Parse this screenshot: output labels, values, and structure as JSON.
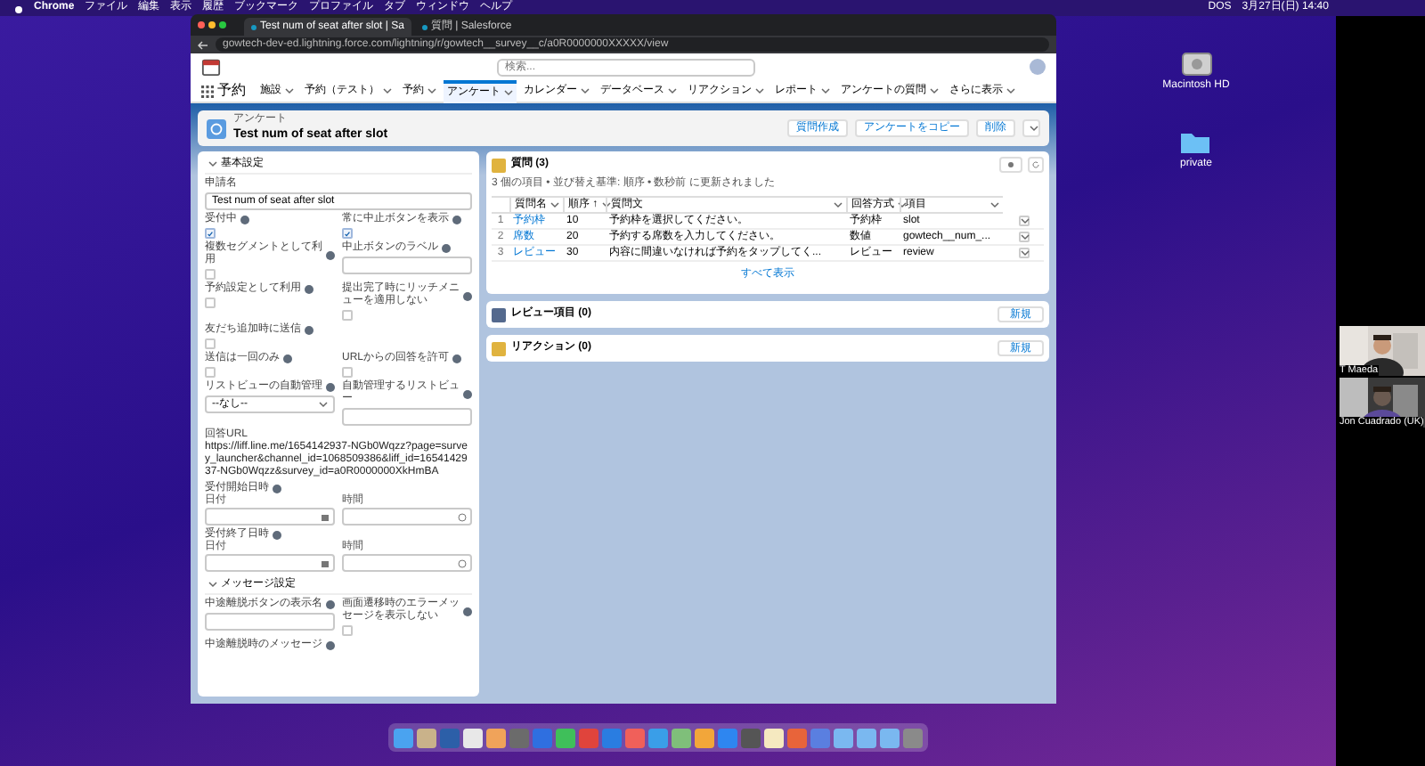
{
  "menu_bar": {
    "app": "Chrome",
    "items": [
      "ファイル",
      "編集",
      "表示",
      "履歴",
      "ブックマーク",
      "プロファイル",
      "タブ",
      "ウィンドウ",
      "ヘルプ"
    ],
    "status": [
      "DOS",
      "3月27日(日) 14:40"
    ]
  },
  "browser": {
    "tabs": [
      {
        "title": "Test num of seat after slot | Sa",
        "selected": true
      },
      {
        "title": "質問 | Salesforce",
        "selected": false
      }
    ],
    "url": "gowtech-dev-ed.lightning.force.com/lightning/r/gowtech__survey__c/a0R0000000XXXXX/view"
  },
  "header": {
    "search_placeholder": "検索..."
  },
  "nav": {
    "app_name": "予約",
    "items": [
      {
        "label": "施設",
        "selected": false
      },
      {
        "label": "予約（テスト）",
        "selected": false
      },
      {
        "label": "予約",
        "selected": false
      },
      {
        "label": "アンケート",
        "selected": true
      },
      {
        "label": "カレンダー",
        "selected": false
      },
      {
        "label": "データベース",
        "selected": false
      },
      {
        "label": "リアクション",
        "selected": false
      },
      {
        "label": "レポート",
        "selected": false
      },
      {
        "label": "アンケートの質問",
        "selected": false
      },
      {
        "label": "さらに表示",
        "selected": false
      }
    ]
  },
  "record": {
    "object": "アンケート",
    "title": "Test num of seat after slot",
    "buttons": [
      "質問作成",
      "アンケートをコピー",
      "削除"
    ]
  },
  "sections": [
    {
      "title": "基本設定",
      "fields": [
        {
          "kind": "text",
          "label": "申請名",
          "value": "Test num of seat after slot",
          "wide": true,
          "help": false
        },
        {
          "kind": "checkbox",
          "label": "受付中",
          "checked": true,
          "help": true
        },
        {
          "kind": "checkbox",
          "label": "常に中止ボタンを表示",
          "checked": true,
          "help": true
        },
        {
          "kind": "checkbox",
          "label": "複数セグメントとして利用",
          "checked": false,
          "help": true
        },
        {
          "kind": "text",
          "label": "中止ボタンのラベル",
          "help": true
        },
        {
          "kind": "checkbox",
          "label": "予約設定として利用",
          "checked": false,
          "help": true
        },
        {
          "kind": "checkbox",
          "label": "提出完了時にリッチメニューを適用しない",
          "checked": false,
          "help": true
        },
        {
          "kind": "checkbox",
          "label": "友だち追加時に送信",
          "checked": false,
          "help": true
        },
        {
          "kind": "empty"
        },
        {
          "kind": "checkbox",
          "label": "送信は一回のみ",
          "checked": false,
          "help": true
        },
        {
          "kind": "checkbox",
          "label": "URLからの回答を許可",
          "checked": false,
          "help": true
        },
        {
          "kind": "select",
          "label": "リストビューの自動管理",
          "value": "--なし--",
          "help": true
        },
        {
          "kind": "text",
          "label": "自動管理するリストビュー",
          "help": true
        },
        {
          "kind": "link",
          "label": "回答URL",
          "value": "https://liff.line.me/1654142937-NGb0Wqzz?page=survey_launcher&channel_id=1068509386&liff_id=1654142937-NGb0Wqzz&survey_id=a0R0000000XkHmBA",
          "wide": true,
          "help": false
        },
        {
          "kind": "datetime",
          "label": "受付開始日時",
          "date_label": "日付",
          "time_label": "時間",
          "wide": true,
          "help": true
        },
        {
          "kind": "datetime",
          "label": "受付終了日時",
          "date_label": "日付",
          "time_label": "時間",
          "wide": true,
          "help": true
        }
      ]
    },
    {
      "title": "メッセージ設定",
      "fields": [
        {
          "kind": "text",
          "label": "中途離脱ボタンの表示名",
          "help": true
        },
        {
          "kind": "checkbox",
          "label": "画面遷移時のエラーメッセージを表示しない",
          "checked": false,
          "help": true
        },
        {
          "kind": "label",
          "label": "中途離脱時のメッセージ",
          "help": true
        }
      ]
    }
  ],
  "questions": {
    "title": "質問 (3)",
    "subtitle": "3 個の項目 • 並び替え基準: 順序 • 数秒前 に更新されました",
    "columns": [
      "質問名",
      "順序 ↑",
      "質問文",
      "回答方式",
      "項目"
    ],
    "rows": [
      {
        "num": "1",
        "cells": [
          "予約枠",
          "10",
          "予約枠を選択してください。",
          "予約枠",
          "slot"
        ]
      },
      {
        "num": "2",
        "cells": [
          "席数",
          "20",
          "予約する席数を入力してください。",
          "数値",
          "gowtech__num_..."
        ]
      },
      {
        "num": "3",
        "cells": [
          "レビュー",
          "30",
          "内容に間違いなければ予約をタップしてく...",
          "レビュー",
          "review"
        ]
      }
    ],
    "view_all": "すべて表示"
  },
  "related": [
    {
      "title": "レビュー項目 (0)",
      "button": "新規",
      "color": "#54698d"
    },
    {
      "title": "リアクション (0)",
      "button": "新規",
      "color": "#e0b33f"
    }
  ],
  "desktop_icons": [
    {
      "kind": "disk",
      "label": "Macintosh HD"
    },
    {
      "kind": "folder",
      "label": "private"
    }
  ],
  "video_tiles": [
    {
      "kind": "picture",
      "name": "T Maeda"
    },
    {
      "kind": "picture",
      "name": "Jon Cuadrado (UK)"
    }
  ],
  "dock": [
    {
      "color": "#4aa3f0"
    },
    {
      "color": "#c9b28a"
    },
    {
      "color": "#2c5fa8"
    },
    {
      "color": "#e8e8e8"
    },
    {
      "color": "#f0a35a"
    },
    {
      "color": "#6b6b6b"
    },
    {
      "color": "#2f6fe0"
    },
    {
      "color": "#3fbf5a"
    },
    {
      "color": "#e0443c"
    },
    {
      "color": "#2a7de1"
    },
    {
      "color": "#f0605a"
    },
    {
      "color": "#3a9ee8"
    },
    {
      "color": "#7fbf7a"
    },
    {
      "color": "#f2a63a"
    },
    {
      "color": "#2e86f0"
    },
    {
      "color": "#555555"
    },
    {
      "color": "#f5e9c0"
    },
    {
      "color": "#e8643a"
    },
    {
      "color": "#5a7fe0"
    },
    {
      "color": "#7ab8f0"
    },
    {
      "color": "#7ab8f0"
    },
    {
      "color": "#7ab8f0"
    },
    {
      "color": "#8a8a8a"
    }
  ]
}
